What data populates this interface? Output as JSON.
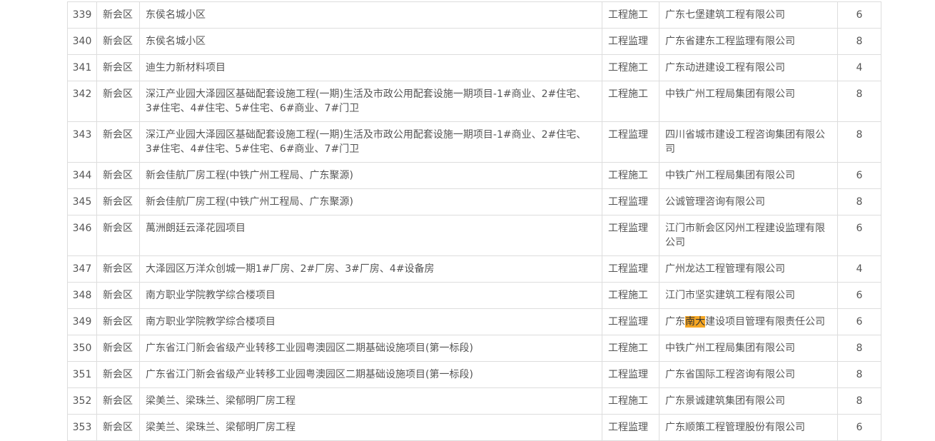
{
  "rows": [
    {
      "no": "339",
      "district": "新会区",
      "project": "东侯名城小区",
      "type": "工程施工",
      "company": "广东七堡建筑工程有限公司",
      "score": "6"
    },
    {
      "no": "340",
      "district": "新会区",
      "project": "东侯名城小区",
      "type": "工程监理",
      "company": "广东省建东工程监理有限公司",
      "score": "8"
    },
    {
      "no": "341",
      "district": "新会区",
      "project": "迪生力新材料项目",
      "type": "工程施工",
      "company": "广东动进建设工程有限公司",
      "score": "4"
    },
    {
      "no": "342",
      "district": "新会区",
      "project": "深江产业园大泽园区基础配套设施工程(一期)生活及市政公用配套设施一期项目-1#商业、2#住宅、3#住宅、4#住宅、5#住宅、6#商业、7#门卫",
      "type": "工程施工",
      "company": "中铁广州工程局集团有限公司",
      "score": "8"
    },
    {
      "no": "343",
      "district": "新会区",
      "project": "深江产业园大泽园区基础配套设施工程(一期)生活及市政公用配套设施一期项目-1#商业、2#住宅、3#住宅、4#住宅、5#住宅、6#商业、7#门卫",
      "type": "工程监理",
      "company": "四川省城市建设工程咨询集团有限公司",
      "score": "8"
    },
    {
      "no": "344",
      "district": "新会区",
      "project": "新会佳航厂房工程(中铁广州工程局、广东聚源)",
      "type": "工程施工",
      "company": "中铁广州工程局集团有限公司",
      "score": "6"
    },
    {
      "no": "345",
      "district": "新会区",
      "project": "新会佳航厂房工程(中铁广州工程局、广东聚源)",
      "type": "工程监理",
      "company": "公诚管理咨询有限公司",
      "score": "8"
    },
    {
      "no": "346",
      "district": "新会区",
      "project": "萬洲朗廷云泽花园项目",
      "type": "工程监理",
      "company": "江门市新会区冈州工程建设监理有限公司",
      "score": "6"
    },
    {
      "no": "347",
      "district": "新会区",
      "project": "大泽园区万洋众创城一期1#厂房、2#厂房、3#厂房、4#设备房",
      "type": "工程监理",
      "company": "广州龙达工程管理有限公司",
      "score": "4"
    },
    {
      "no": "348",
      "district": "新会区",
      "project": "南方职业学院教学综合楼项目",
      "type": "工程施工",
      "company": "江门市坚实建筑工程有限公司",
      "score": "6"
    },
    {
      "no": "349",
      "district": "新会区",
      "project": "南方职业学院教学综合楼项目",
      "type": "工程监理",
      "company_pre": "广东",
      "company_hl": "南大",
      "company_post": "建设项目管理有限责任公司",
      "score": "6"
    },
    {
      "no": "350",
      "district": "新会区",
      "project": "广东省江门新会省级产业转移工业园粤澳园区二期基础设施项目(第一标段)",
      "type": "工程施工",
      "company": "中铁广州工程局集团有限公司",
      "score": "8"
    },
    {
      "no": "351",
      "district": "新会区",
      "project": "广东省江门新会省级产业转移工业园粤澳园区二期基础设施项目(第一标段)",
      "type": "工程监理",
      "company": "广东省国际工程咨询有限公司",
      "score": "8"
    },
    {
      "no": "352",
      "district": "新会区",
      "project": "梁美兰、梁珠兰、梁郁明厂房工程",
      "type": "工程施工",
      "company": "广东景诚建筑集团有限公司",
      "score": "8"
    },
    {
      "no": "353",
      "district": "新会区",
      "project": "梁美兰、梁珠兰、梁郁明厂房工程",
      "type": "工程监理",
      "company": "广东顺策工程管理股份有限公司",
      "score": "6"
    }
  ],
  "colors": {
    "border": "#dddddd",
    "text": "#555555",
    "highlight": "#f5a623"
  }
}
